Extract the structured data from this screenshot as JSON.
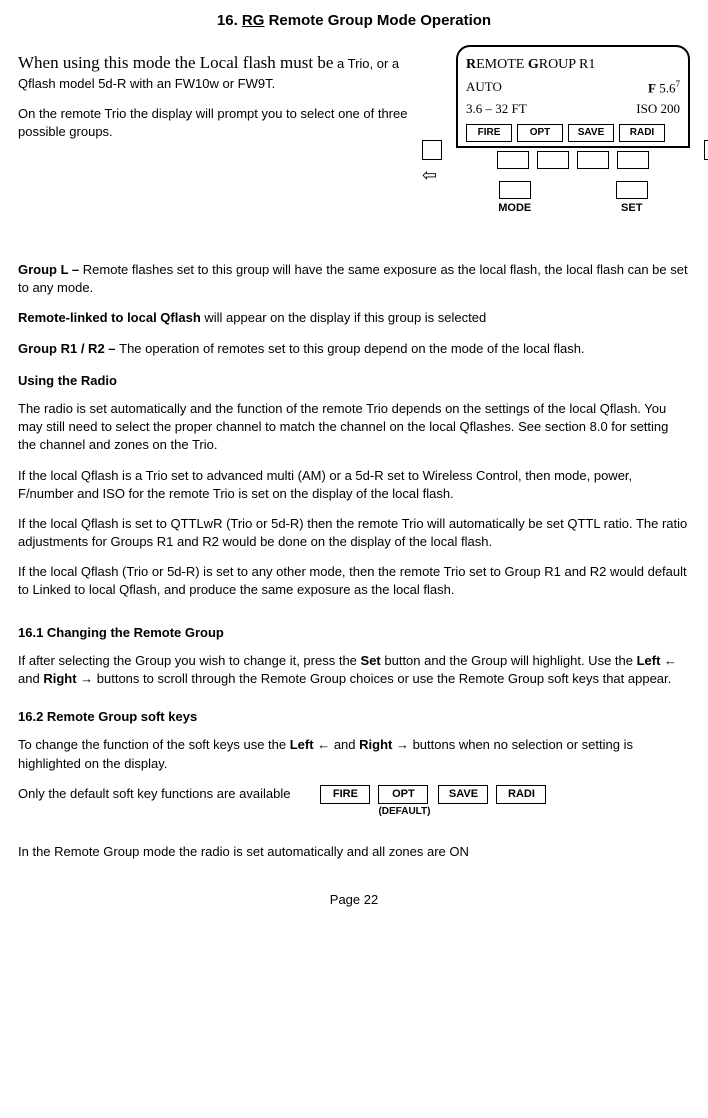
{
  "title_prefix": "16. ",
  "title_rg": "RG",
  "title_rest": "  Remote Group Mode Operation",
  "intro_serif": "When using this mode the Local flash must be",
  "intro_rest": "a Trio, or a Qflash model 5d-R with an FW10w or FW9T.",
  "intro2": "On the remote Trio the display will prompt you to select one of three possible groups.",
  "groupL_label": "Group L – ",
  "groupL_text": "Remote flashes set to this group will  have the same exposure as the local flash, the local flash can be set to any mode.",
  "remote_linked_b": "Remote-linked to local Qflash",
  "remote_linked_rest": " will appear on the display if this group is selected",
  "groupR_label": "Group R1 / R2 – ",
  "groupR_text": "The operation of remotes set to this group depend on the mode of the local flash.",
  "using_radio_h": "Using the Radio",
  "p_radio1": "The radio is set automatically and the function of the remote Trio depends on the settings of the local Qflash. You may still need to select the proper channel to match the channel on the local Qflashes.   See section 8.0 for setting the channel and zones on the Trio.",
  "p_radio2": "If the local Qflash is a Trio set to advanced multi (AM) or a 5d-R set to Wireless Control, then mode, power, F/number and ISO for the remote Trio is set on the display of the local flash.",
  "p_radio3": "If the local Qflash is set to QTTLwR (Trio or 5d-R) then the remote Trio will automatically be set QTTL ratio.  The ratio adjustments for Groups R1 and R2 would be done on the display of the local flash.",
  "p_radio4": "If the local Qflash (Trio or 5d-R) is set to any other mode, then the remote Trio set to Group R1 and R2 would default to Linked to local Qflash, and produce the same exposure as the local flash.",
  "h_161": "16.1  Changing the Remote Group",
  "p_161a": "If after selecting the Group you wish to change it, press the ",
  "p_161_set": "Set",
  "p_161b": " button and the Group will highlight.  Use the ",
  "p_161_left": "Left",
  "p_161_larr": " ← ",
  "p_161_and": " and ",
  "p_161_right": "Right",
  "p_161_rarr": " → ",
  "p_161c": " buttons to scroll through the Remote Group choices or use the Remote Group soft keys that appear.",
  "h_162": "16.2  Remote Group soft keys",
  "p_162a": "To change the function of the soft keys use the ",
  "p_162b": " buttons when no selection or setting is highlighted on the display.",
  "p_162_only": "Only the default soft key functions are available",
  "sk_fire": "FIRE",
  "sk_opt": "OPT",
  "sk_save": "SAVE",
  "sk_radi": "RADI",
  "sk_default": "(DEFAULT)",
  "p_last": "In the Remote Group mode the radio is set automatically and all zones are ON",
  "footer": "Page 22",
  "lcd": {
    "l1_a": "R",
    "l1_b": "EMOTE ",
    "l1_c": "G",
    "l1_d": "ROUP  R1",
    "l2_left": "AUTO",
    "l2_f": "F",
    "l2_fv": " 5.6",
    "l2_sup": "7",
    "l3_left": "3.6 – 32 FT",
    "l3_right": "ISO 200",
    "mode": "MODE",
    "set": "SET"
  }
}
